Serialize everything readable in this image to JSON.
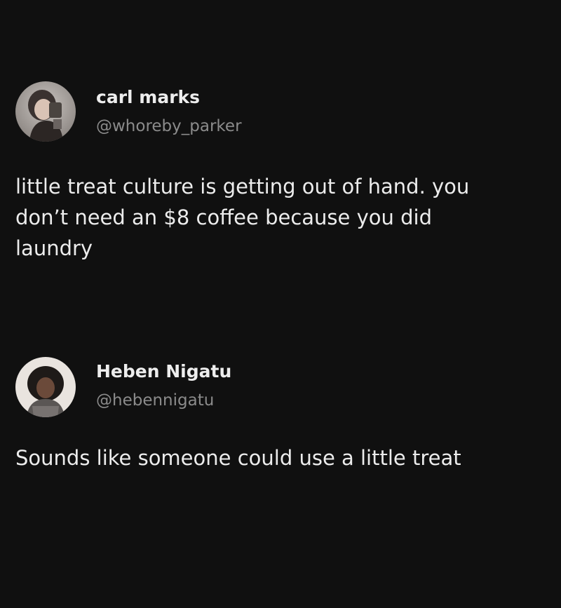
{
  "posts": [
    {
      "display_name": "carl marks",
      "handle": "@whoreby_parker",
      "avatar_icon": "user-photo-avatar",
      "text": "little treat culture is getting out of hand. you\ndon’t need an $8 coffee because you did\nlaundry"
    },
    {
      "display_name": "Heben Nigatu",
      "handle": "@hebennigatu",
      "avatar_icon": "user-photo-avatar",
      "text": "Sounds like someone could use a little treat"
    }
  ],
  "colors": {
    "background": "#101010",
    "name": "#ededed",
    "handle": "#8b8b8b",
    "text": "#ececec"
  }
}
